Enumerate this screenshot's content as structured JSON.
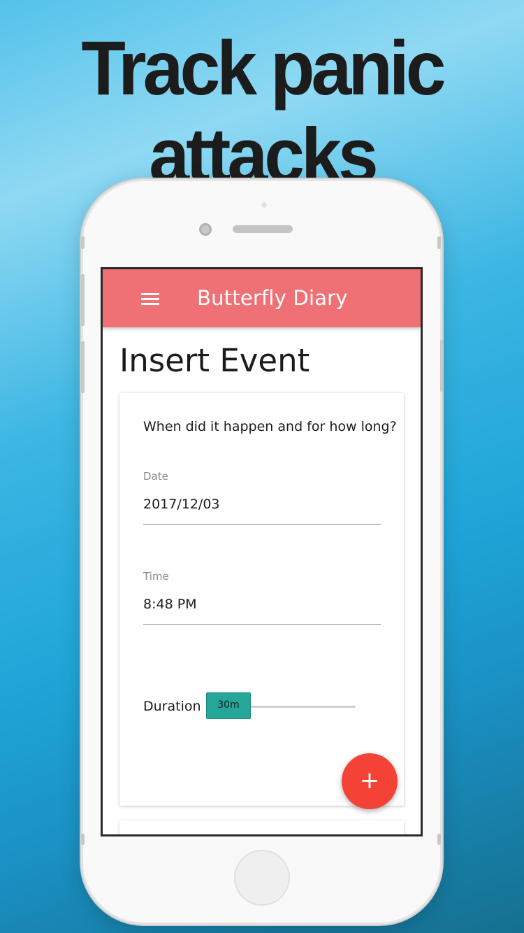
{
  "promo": {
    "headline": "Track panic attacks"
  },
  "appbar": {
    "menu_icon": "hamburger-menu-icon",
    "title": "Butterfly Diary",
    "color": "#ef7075"
  },
  "page": {
    "title": "Insert Event"
  },
  "form": {
    "question": "When did it happen and for how long?",
    "date": {
      "label": "Date",
      "value": "2017/12/03"
    },
    "time": {
      "label": "Time",
      "value": "8:48 PM"
    },
    "duration": {
      "label": "Duration",
      "value_label": "30m",
      "slider_position_fraction": 0.0,
      "accent": "#26a69a"
    }
  },
  "fab": {
    "icon": "plus-icon",
    "glyph": "+",
    "color": "#f44336"
  }
}
